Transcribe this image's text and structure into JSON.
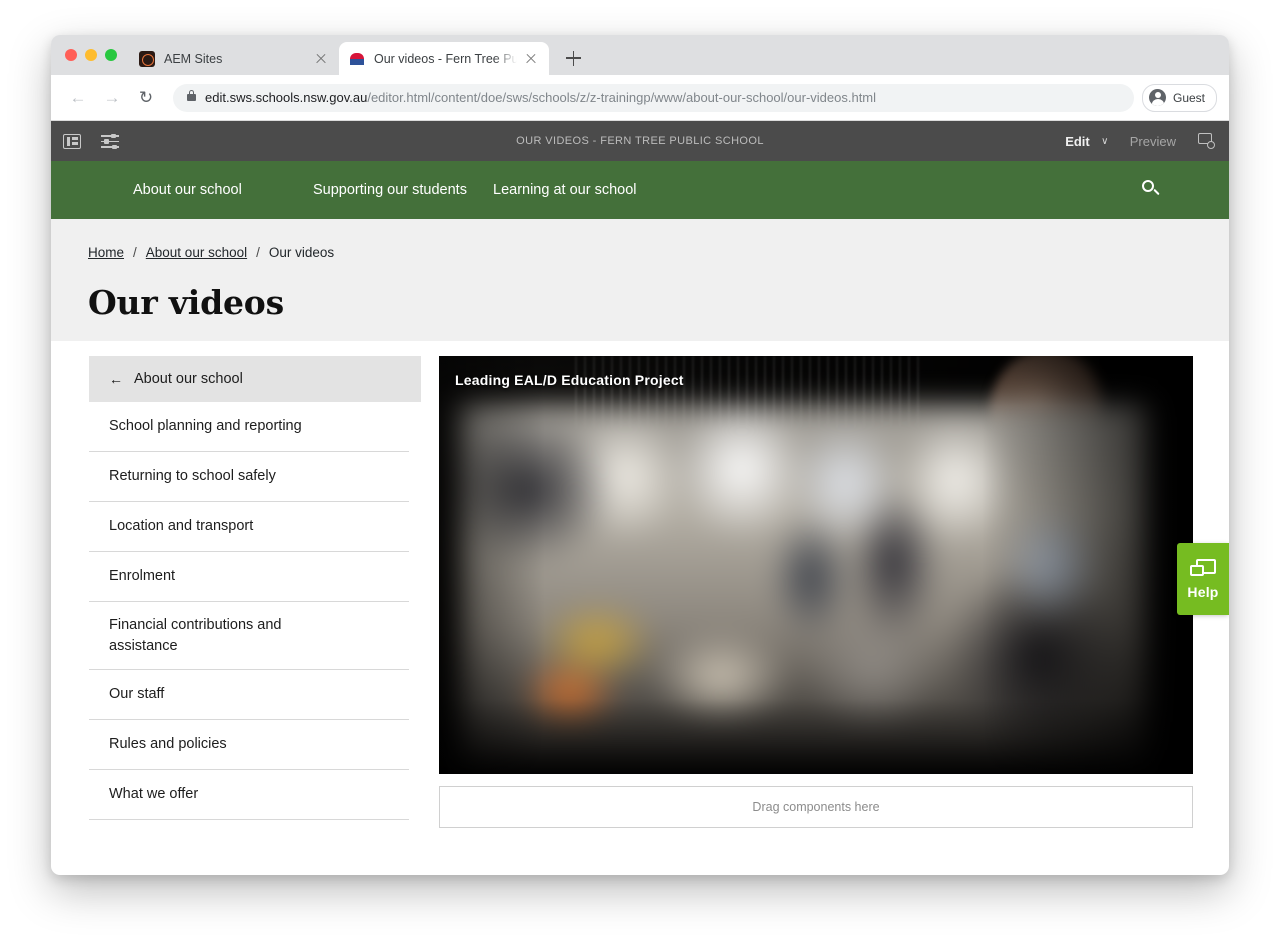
{
  "browser": {
    "tabs": [
      {
        "title": "AEM Sites",
        "favicon": "aem-favicon",
        "active": false
      },
      {
        "title": "Our videos - Fern Tree Public S",
        "favicon": "nsw-favicon",
        "active": true
      }
    ],
    "new_tab_label": "+",
    "back_label": "←",
    "forward_label": "→",
    "reload_label": "↻",
    "url_host": "edit.sws.schools.nsw.gov.au",
    "url_path": "/editor.html/content/doe/sws/schools/z/z-trainingp/www/about-our-school/our-videos.html",
    "url_full": "edit.sws.schools.nsw.gov.au/editor.html/content/doe/sws/schools/z/z-trainingp/www/about-our-school/our-videos.html",
    "profile_label": "Guest"
  },
  "editor_toolbar": {
    "page_title": "OUR VIDEOS - FERN TREE PUBLIC SCHOOL",
    "edit_label": "Edit",
    "edit_caret": "∨",
    "preview_label": "Preview",
    "icons": {
      "sidebar_toggle": "panel-icon",
      "page_properties": "sliders-icon",
      "annotations": "annotation-icon"
    }
  },
  "site_nav": {
    "items": [
      {
        "label": "About our school"
      },
      {
        "label": "Supporting our students"
      },
      {
        "label": "Learning at our school"
      }
    ],
    "search_icon": "search-icon",
    "background_color": "#44703a"
  },
  "breadcrumb": {
    "items": [
      {
        "label": "Home",
        "link": true
      },
      {
        "label": "About our school",
        "link": true
      },
      {
        "label": "Our videos",
        "link": false
      }
    ],
    "separator": "/"
  },
  "page": {
    "title": "Our videos"
  },
  "sidebar": {
    "header": {
      "label": "About our school",
      "back_arrow": "←"
    },
    "items": [
      {
        "label": "School planning and reporting"
      },
      {
        "label": "Returning to school safely"
      },
      {
        "label": "Location and transport"
      },
      {
        "label": "Enrolment"
      },
      {
        "label": "Financial contributions and assistance"
      },
      {
        "label": "Our staff"
      },
      {
        "label": "Rules and policies"
      },
      {
        "label": "What we offer"
      }
    ]
  },
  "main": {
    "video": {
      "title": "Leading EAL/D Education Project"
    },
    "dropzone": {
      "label": "Drag components here"
    }
  },
  "help_widget": {
    "label": "Help",
    "icon": "chat-bubble-icon",
    "color": "#76bc21"
  }
}
